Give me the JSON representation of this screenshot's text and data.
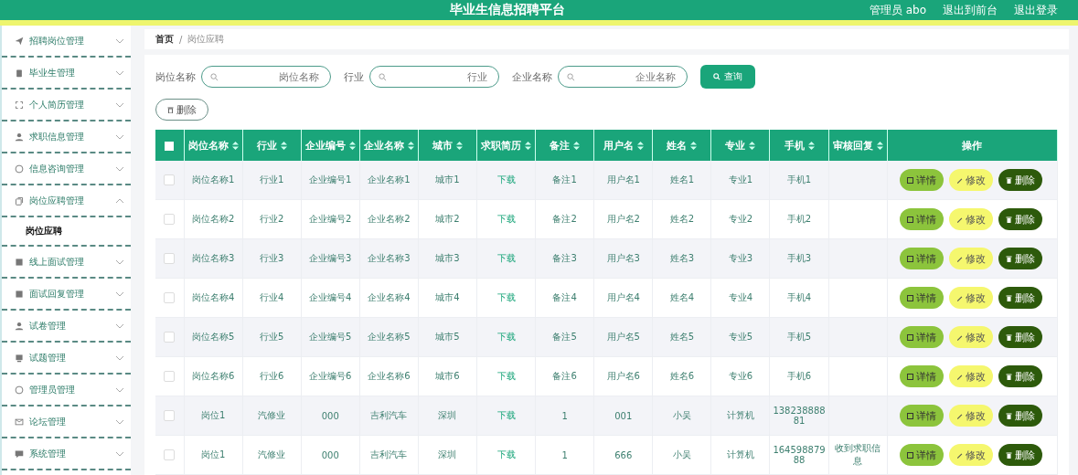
{
  "header": {
    "title": "毕业生信息招聘平台",
    "user": "管理员 abo",
    "links": [
      "退出到前台",
      "退出登录"
    ]
  },
  "sidebar": {
    "items": [
      {
        "label": "招聘岗位管理",
        "expanded": false
      },
      {
        "label": "毕业生管理",
        "expanded": false
      },
      {
        "label": "个人简历管理",
        "expanded": false
      },
      {
        "label": "求职信息管理",
        "expanded": false
      },
      {
        "label": "信息咨询管理",
        "expanded": false
      },
      {
        "label": "岗位应聘管理",
        "expanded": true,
        "children": [
          {
            "label": "岗位应聘",
            "selected": true
          }
        ]
      },
      {
        "label": "线上面试管理",
        "expanded": false
      },
      {
        "label": "面试回复管理",
        "expanded": false
      },
      {
        "label": "试卷管理",
        "expanded": false
      },
      {
        "label": "试题管理",
        "expanded": false
      },
      {
        "label": "管理员管理",
        "expanded": false
      },
      {
        "label": "论坛管理",
        "expanded": false
      },
      {
        "label": "系统管理",
        "expanded": false
      }
    ]
  },
  "breadcrumb": [
    "首页",
    "/",
    "岗位应聘"
  ],
  "search": {
    "fields": [
      {
        "label": "岗位名称",
        "placeholder": "岗位名称"
      },
      {
        "label": "行业",
        "placeholder": "行业"
      },
      {
        "label": "企业名称",
        "placeholder": "企业名称"
      }
    ],
    "button": "查询"
  },
  "delete_button": "删除",
  "table": {
    "select_all": {
      "checked": false
    },
    "columns": [
      {
        "label": "岗位名称",
        "sortable": true
      },
      {
        "label": "行业",
        "sortable": true
      },
      {
        "label": "企业编号",
        "sortable": true
      },
      {
        "label": "企业名称",
        "sortable": true
      },
      {
        "label": "城市",
        "sortable": true
      },
      {
        "label": "求职简历",
        "sortable": true
      },
      {
        "label": "备注",
        "sortable": true
      },
      {
        "label": "用户名",
        "sortable": true
      },
      {
        "label": "姓名",
        "sortable": true
      },
      {
        "label": "专业",
        "sortable": true
      },
      {
        "label": "手机",
        "sortable": true
      },
      {
        "label": "审核回复",
        "sortable": true
      },
      {
        "label": "操作",
        "sortable": false
      }
    ],
    "rows": [
      {
        "checked": false,
        "cells": [
          "岗位名称1",
          "行业1",
          "企业编号1",
          "企业名称1",
          "城市1",
          "下载",
          "备注1",
          "用户名1",
          "姓名1",
          "专业1",
          "手机1",
          ""
        ],
        "actions": [
          {
            "label": "详情",
            "kind": "detail"
          },
          {
            "label": "修改",
            "kind": "edit"
          },
          {
            "label": "删除",
            "kind": "delete"
          }
        ]
      },
      {
        "checked": false,
        "cells": [
          "岗位名称2",
          "行业2",
          "企业编号2",
          "企业名称2",
          "城市2",
          "下载",
          "备注2",
          "用户名2",
          "姓名2",
          "专业2",
          "手机2",
          ""
        ],
        "actions": [
          {
            "label": "详情",
            "kind": "detail"
          },
          {
            "label": "修改",
            "kind": "edit"
          },
          {
            "label": "删除",
            "kind": "delete"
          }
        ]
      },
      {
        "checked": false,
        "cells": [
          "岗位名称3",
          "行业3",
          "企业编号3",
          "企业名称3",
          "城市3",
          "下载",
          "备注3",
          "用户名3",
          "姓名3",
          "专业3",
          "手机3",
          ""
        ],
        "actions": [
          {
            "label": "详情",
            "kind": "detail"
          },
          {
            "label": "修改",
            "kind": "edit"
          },
          {
            "label": "删除",
            "kind": "delete"
          }
        ]
      },
      {
        "checked": false,
        "cells": [
          "岗位名称4",
          "行业4",
          "企业编号4",
          "企业名称4",
          "城市4",
          "下载",
          "备注4",
          "用户名4",
          "姓名4",
          "专业4",
          "手机4",
          ""
        ],
        "actions": [
          {
            "label": "详情",
            "kind": "detail"
          },
          {
            "label": "修改",
            "kind": "edit"
          },
          {
            "label": "删除",
            "kind": "delete"
          }
        ]
      },
      {
        "checked": false,
        "cells": [
          "岗位名称5",
          "行业5",
          "企业编号5",
          "企业名称5",
          "城市5",
          "下载",
          "备注5",
          "用户名5",
          "姓名5",
          "专业5",
          "手机5",
          ""
        ],
        "actions": [
          {
            "label": "详情",
            "kind": "detail"
          },
          {
            "label": "修改",
            "kind": "edit"
          },
          {
            "label": "删除",
            "kind": "delete"
          }
        ]
      },
      {
        "checked": false,
        "cells": [
          "岗位名称6",
          "行业6",
          "企业编号6",
          "企业名称6",
          "城市6",
          "下载",
          "备注6",
          "用户名6",
          "姓名6",
          "专业6",
          "手机6",
          ""
        ],
        "actions": [
          {
            "label": "详情",
            "kind": "detail"
          },
          {
            "label": "修改",
            "kind": "edit"
          },
          {
            "label": "删除",
            "kind": "delete"
          }
        ]
      },
      {
        "checked": false,
        "cells": [
          "岗位1",
          "汽修业",
          "000",
          "吉利汽车",
          "深圳",
          "下载",
          "1",
          "001",
          "小吴",
          "计算机",
          "13823888881",
          ""
        ],
        "actions": [
          {
            "label": "详情",
            "kind": "detail"
          },
          {
            "label": "修改",
            "kind": "edit"
          },
          {
            "label": "删除",
            "kind": "delete"
          }
        ]
      },
      {
        "checked": false,
        "cells": [
          "岗位1",
          "汽修业",
          "000",
          "吉利汽车",
          "深圳",
          "下载",
          "1",
          "666",
          "小吴",
          "计算机",
          "16459887988",
          "收到求职信息"
        ],
        "actions": [
          {
            "label": "详情",
            "kind": "detail"
          },
          {
            "label": "修改",
            "kind": "edit"
          },
          {
            "label": "删除",
            "kind": "delete"
          }
        ]
      }
    ]
  }
}
